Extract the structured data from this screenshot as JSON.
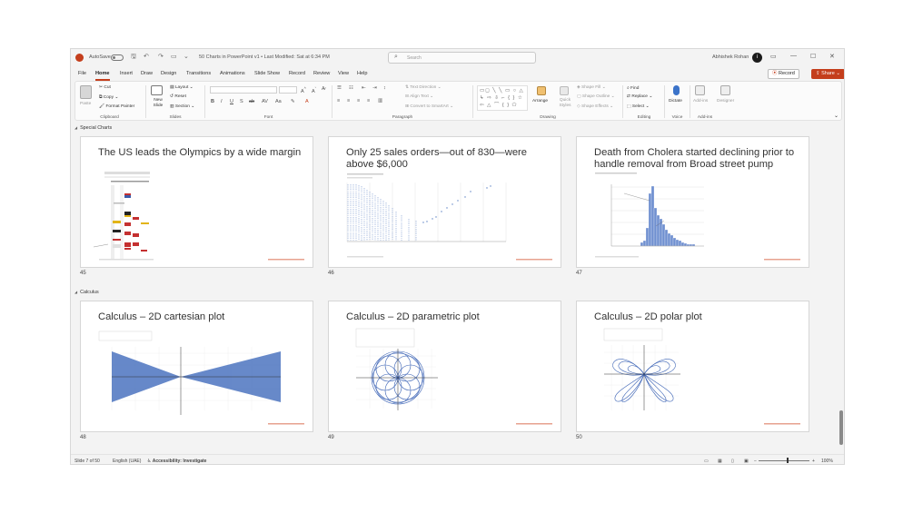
{
  "titlebar": {
    "autosave": "AutoSave",
    "file_name": "50 Charts in PowerPoint v1 • Last Modified: Sat at 6:34 PM",
    "search_placeholder": "Search",
    "user_name": "Abhishek Rohan",
    "avatar": "i"
  },
  "tabs": [
    "File",
    "Home",
    "Insert",
    "Draw",
    "Design",
    "Transitions",
    "Animations",
    "Slide Show",
    "Record",
    "Review",
    "View",
    "Help"
  ],
  "active_tab": "Home",
  "actions": {
    "record": "Record",
    "share": "Share"
  },
  "ribbon": {
    "clipboard": {
      "label": "Clipboard",
      "paste": "Paste",
      "cut": "Cut",
      "copy": "Copy",
      "format_painter": "Format Painter"
    },
    "slides": {
      "label": "Slides",
      "new_slide": "New Slide",
      "layout": "Layout",
      "reset": "Reset",
      "section": "Section"
    },
    "font": {
      "label": "Font"
    },
    "paragraph": {
      "label": "Paragraph",
      "text_direction": "Text Direction",
      "align_text": "Align Text",
      "convert_smartart": "Convert to SmartArt"
    },
    "drawing": {
      "label": "Drawing",
      "arrange": "Arrange",
      "quick_styles": "Quick Styles",
      "shape_fill": "Shape Fill",
      "shape_outline": "Shape Outline",
      "shape_effects": "Shape Effects"
    },
    "editing": {
      "label": "Editing",
      "find": "Find",
      "replace": "Replace",
      "select": "Select"
    },
    "voice": {
      "label": "Voice",
      "dictate": "Dictate"
    },
    "addins": {
      "label": "Add-ins",
      "add_ins": "Add-ins",
      "designer": "Designer"
    }
  },
  "sections": [
    {
      "name": "Special Charts",
      "slides": [
        {
          "number": "45",
          "title": "The US leads the Olympics by a wide margin"
        },
        {
          "number": "46",
          "title": "Only 25 sales orders—out of 830—were above $6,000"
        },
        {
          "number": "47",
          "title": "Death from Cholera started declining prior to handle removal from Broad street pump"
        }
      ]
    },
    {
      "name": "Calculus",
      "slides": [
        {
          "number": "48",
          "title": "Calculus – 2D cartesian plot"
        },
        {
          "number": "49",
          "title": "Calculus – 2D parametric plot"
        },
        {
          "number": "50",
          "title": "Calculus – 2D polar plot"
        }
      ]
    }
  ],
  "status": {
    "slide_info": "Slide 7 of 50",
    "language": "English (UAE)",
    "accessibility": "Accessibility: Investigate",
    "zoom": "100%"
  }
}
